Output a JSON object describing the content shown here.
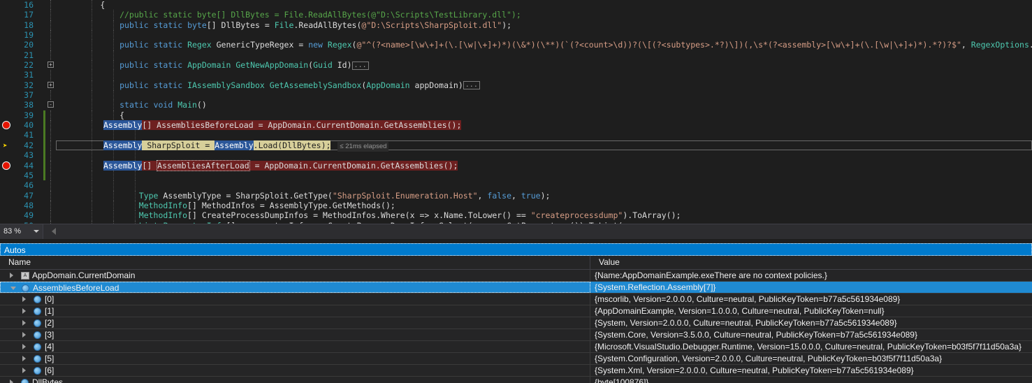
{
  "editor": {
    "zoom_level": "83 %",
    "lines": [
      {
        "num": "16",
        "bp": false,
        "arrow": false,
        "change": false,
        "fold": "",
        "indent": 1,
        "html_key": "l16"
      },
      {
        "num": "17",
        "bp": false,
        "arrow": false,
        "change": false,
        "fold": "",
        "indent": 2,
        "html_key": "l17"
      },
      {
        "num": "18",
        "bp": false,
        "arrow": false,
        "change": false,
        "fold": "",
        "indent": 2,
        "html_key": "l18"
      },
      {
        "num": "19",
        "bp": false,
        "arrow": false,
        "change": false,
        "fold": "",
        "indent": 2,
        "html_key": "l19"
      },
      {
        "num": "20",
        "bp": false,
        "arrow": false,
        "change": false,
        "fold": "",
        "indent": 2,
        "html_key": "l20"
      },
      {
        "num": "21",
        "bp": false,
        "arrow": false,
        "change": false,
        "fold": "",
        "indent": 2,
        "html_key": "l21"
      },
      {
        "num": "22",
        "bp": false,
        "arrow": false,
        "change": false,
        "fold": "+",
        "indent": 2,
        "html_key": "l22"
      },
      {
        "num": "31",
        "bp": false,
        "arrow": false,
        "change": false,
        "fold": "",
        "indent": 2,
        "html_key": "l31"
      },
      {
        "num": "32",
        "bp": false,
        "arrow": false,
        "change": false,
        "fold": "+",
        "indent": 2,
        "html_key": "l32"
      },
      {
        "num": "37",
        "bp": false,
        "arrow": false,
        "change": false,
        "fold": "",
        "indent": 2,
        "html_key": "l37"
      },
      {
        "num": "38",
        "bp": false,
        "arrow": false,
        "change": false,
        "fold": "-",
        "indent": 2,
        "html_key": "l38"
      },
      {
        "num": "39",
        "bp": false,
        "arrow": false,
        "change": true,
        "fold": "",
        "indent": 2,
        "html_key": "l39"
      },
      {
        "num": "40",
        "bp": true,
        "arrow": false,
        "change": true,
        "fold": "",
        "indent": 3,
        "html_key": "l40"
      },
      {
        "num": "41",
        "bp": false,
        "arrow": false,
        "change": true,
        "fold": "",
        "indent": 3,
        "html_key": "l41"
      },
      {
        "num": "42",
        "bp": false,
        "arrow": true,
        "change": true,
        "fold": "",
        "indent": 3,
        "html_key": "l42"
      },
      {
        "num": "43",
        "bp": false,
        "arrow": false,
        "change": true,
        "fold": "",
        "indent": 3,
        "html_key": "l43"
      },
      {
        "num": "44",
        "bp": true,
        "arrow": false,
        "change": true,
        "fold": "",
        "indent": 3,
        "html_key": "l44"
      },
      {
        "num": "45",
        "bp": false,
        "arrow": false,
        "change": true,
        "fold": "",
        "indent": 3,
        "html_key": "l45"
      },
      {
        "num": "46",
        "bp": false,
        "arrow": false,
        "change": false,
        "fold": "",
        "indent": 3,
        "html_key": "l46"
      },
      {
        "num": "47",
        "bp": false,
        "arrow": false,
        "change": false,
        "fold": "",
        "indent": 3,
        "html_key": "l47"
      },
      {
        "num": "48",
        "bp": false,
        "arrow": false,
        "change": false,
        "fold": "",
        "indent": 3,
        "html_key": "l48"
      },
      {
        "num": "49",
        "bp": false,
        "arrow": false,
        "change": false,
        "fold": "",
        "indent": 3,
        "html_key": "l49"
      },
      {
        "num": "50",
        "bp": false,
        "arrow": false,
        "change": false,
        "fold": "",
        "indent": 3,
        "html_key": "l50"
      }
    ],
    "text": {
      "l16": "        {",
      "l17": "            //public static byte[] DllBytes = File.ReadAllBytes(@\"D:\\Scripts\\TestLibrary.dll\");",
      "l18": "            public static byte[] DllBytes = File.ReadAllBytes(@\"D:\\Scripts\\SharpSploit.dll\");",
      "l19": "",
      "l20": "            public static Regex GenericTypeRegex = new Regex(@\"^(?<name>[\\w\\+]+(\\.[\\w|\\+]+)*)(\\&*)(\\**)(`(?<count>\\d))?(\\[(?<subtypes>.*?)\\])(,\\s*(?<assembly>[\\w\\+]+(\\.[\\w|\\+]+)*).*?)?$\", RegexOptions.Compiled | RegexOptions.Singleline | Re",
      "l21": "",
      "l22": "            public static AppDomain GetNewAppDomain(Guid Id)",
      "l31": "",
      "l32": "            public static IAssemblySandbox GetAssemeblySandbox(AppDomain appDomain)",
      "l37": "",
      "l38": "            static void Main()",
      "l39": "            {",
      "l40": "Assembly[] AssembliesBeforeLoad = AppDomain.CurrentDomain.GetAssemblies();",
      "l41": "",
      "l42": "Assembly SharpSploit = Assembly.Load(DllBytes);",
      "l43": "",
      "l44": "Assembly[] AssembliesAfterLoad = AppDomain.CurrentDomain.GetAssemblies();",
      "l45": "",
      "l46": "",
      "l47": "                Type AssemblyType = SharpSploit.GetType(\"SharpSploit.Enumeration.Host\", false, true);",
      "l48": "                MethodInfo[] MethodInfos = AssemblyType.GetMethods();",
      "l49": "                MethodInfo[] CreateProcessDumpInfos = MethodInfos.Where(x => x.Name.ToLower() == \"createprocessdump\").ToArray();",
      "l50": "                List<ParameterInfo[]> parameterInfos = CreateProcessDumpInfos.Select(x => x.GetParameters()).ToList("
    },
    "elapsed_hint": "≤ 21ms elapsed",
    "fold_ellipsis": "...",
    "colors": {
      "background": "#1e1e1e",
      "keyword": "#569cd6",
      "type": "#4ec9b0",
      "string": "#d69d85",
      "comment": "#57a64a",
      "linenumber": "#2b91af",
      "breakpoint": "#e51400",
      "current_statement_highlight": "#d7cf9a",
      "breakpoint_line_highlight": "#6e2020",
      "selection_blue": "#2a5699"
    }
  },
  "autos": {
    "title": "Autos",
    "columns": {
      "name": "Name",
      "value": "Value"
    },
    "rows": [
      {
        "name": "AppDomain.CurrentDomain",
        "value": "{Name:AppDomainExample.exeThere are no context policies.}",
        "depth": 0,
        "expander": "collapsed",
        "icon": "appdomain-icon",
        "selected": false
      },
      {
        "name": "AssembliesBeforeLoad",
        "value": "{System.Reflection.Assembly[7]}",
        "depth": 0,
        "expander": "expanded",
        "icon": "field-icon",
        "selected": true
      },
      {
        "name": "[0]",
        "value": "{mscorlib, Version=2.0.0.0, Culture=neutral, PublicKeyToken=b77a5c561934e089}",
        "depth": 1,
        "expander": "collapsed",
        "icon": "field-icon",
        "selected": false
      },
      {
        "name": "[1]",
        "value": "{AppDomainExample, Version=1.0.0.0, Culture=neutral, PublicKeyToken=null}",
        "depth": 1,
        "expander": "collapsed",
        "icon": "field-icon",
        "selected": false
      },
      {
        "name": "[2]",
        "value": "{System, Version=2.0.0.0, Culture=neutral, PublicKeyToken=b77a5c561934e089}",
        "depth": 1,
        "expander": "collapsed",
        "icon": "field-icon",
        "selected": false
      },
      {
        "name": "[3]",
        "value": "{System.Core, Version=3.5.0.0, Culture=neutral, PublicKeyToken=b77a5c561934e089}",
        "depth": 1,
        "expander": "collapsed",
        "icon": "field-icon",
        "selected": false
      },
      {
        "name": "[4]",
        "value": "{Microsoft.VisualStudio.Debugger.Runtime, Version=15.0.0.0, Culture=neutral, PublicKeyToken=b03f5f7f11d50a3a}",
        "depth": 1,
        "expander": "collapsed",
        "icon": "field-icon",
        "selected": false
      },
      {
        "name": "[5]",
        "value": "{System.Configuration, Version=2.0.0.0, Culture=neutral, PublicKeyToken=b03f5f7f11d50a3a}",
        "depth": 1,
        "expander": "collapsed",
        "icon": "field-icon",
        "selected": false
      },
      {
        "name": "[6]",
        "value": "{System.Xml, Version=2.0.0.0, Culture=neutral, PublicKeyToken=b77a5c561934e089}",
        "depth": 1,
        "expander": "collapsed",
        "icon": "field-icon",
        "selected": false
      },
      {
        "name": "DllBytes",
        "value": "{byte[100876]}",
        "depth": 0,
        "expander": "collapsed",
        "icon": "field-icon",
        "selected": false
      }
    ],
    "colors": {
      "title_bar": "#007acc",
      "selection": "#1f8ad2"
    }
  }
}
